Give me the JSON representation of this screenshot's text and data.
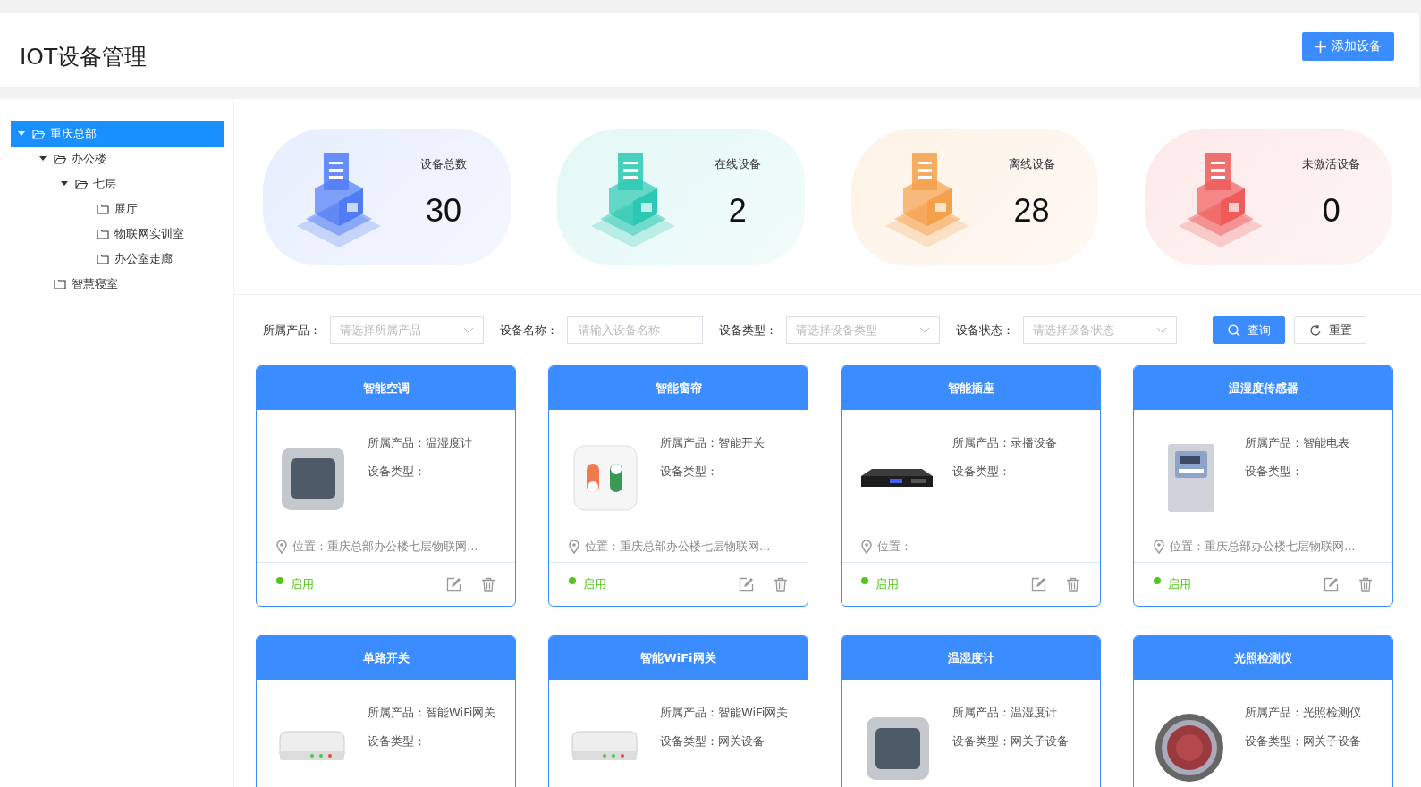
{
  "header": {
    "title": "IOT设备管理",
    "add_button": "添加设备"
  },
  "tree": [
    {
      "label": "重庆总部",
      "selected": true,
      "expanded": true,
      "children": [
        {
          "label": "办公楼",
          "selected": false,
          "expanded": true,
          "children": [
            {
              "label": "七层",
              "selected": false,
              "expanded": true,
              "children": [
                {
                  "label": "展厅",
                  "selected": false,
                  "expanded": false
                },
                {
                  "label": "物联网实训室",
                  "selected": false,
                  "expanded": false
                },
                {
                  "label": "办公室走廊",
                  "selected": false,
                  "expanded": false
                }
              ]
            }
          ]
        },
        {
          "label": "智慧寝室",
          "selected": false,
          "expanded": false
        }
      ]
    }
  ],
  "stats": [
    {
      "label": "设备总数",
      "value": "30",
      "color": "#4f7cf5"
    },
    {
      "label": "在线设备",
      "value": "2",
      "color": "#2bc9b4"
    },
    {
      "label": "离线设备",
      "value": "28",
      "color": "#f5a04a"
    },
    {
      "label": "未激活设备",
      "value": "0",
      "color": "#ef5b5b"
    }
  ],
  "filters": [
    {
      "kind": "select",
      "label": "所属产品：",
      "placeholder": "请选择所属产品"
    },
    {
      "kind": "input",
      "label": "设备名称：",
      "placeholder": "请输入设备名称"
    },
    {
      "kind": "select",
      "label": "设备类型：",
      "placeholder": "请选择设备类型"
    },
    {
      "kind": "select",
      "label": "设备状态：",
      "placeholder": "请选择设备状态"
    }
  ],
  "buttons": [
    {
      "kind": "search",
      "label": "查询"
    },
    {
      "kind": "reset",
      "label": "重置"
    }
  ],
  "devices": [
    {
      "title": "智能空调",
      "fields": [
        {
          "label": "所属产品：",
          "value": "温湿度计"
        },
        {
          "label": "设备类型："
        }
      ],
      "location": {
        "label": "位置：",
        "value": "重庆总部办公楼七层物联网..."
      },
      "status": {
        "label": "启用",
        "on": true
      }
    },
    {
      "title": "智能窗帘",
      "fields": [
        {
          "label": "所属产品：",
          "value": "智能开关"
        },
        {
          "label": "设备类型："
        }
      ],
      "location": {
        "label": "位置：",
        "value": "重庆总部办公楼七层物联网..."
      },
      "status": {
        "label": "启用",
        "on": true
      }
    },
    {
      "title": "智能插座",
      "fields": [
        {
          "label": "所属产品：",
          "value": "录播设备"
        },
        {
          "label": "设备类型："
        }
      ],
      "location": {
        "label": "位置："
      },
      "status": {
        "label": "启用",
        "on": true
      }
    },
    {
      "title": "温湿度传感器",
      "fields": [
        {
          "label": "所属产品：",
          "value": "智能电表"
        },
        {
          "label": "设备类型："
        }
      ],
      "location": {
        "label": "位置：",
        "value": "重庆总部办公楼七层物联网..."
      },
      "status": {
        "label": "启用",
        "on": true
      }
    },
    {
      "title": "单路开关",
      "fields": [
        {
          "label": "所属产品：",
          "value": "智能WiFi网关"
        },
        {
          "label": "设备类型："
        }
      ]
    },
    {
      "title": "智能WiFi网关",
      "fields": [
        {
          "label": "所属产品：",
          "value": "智能WiFi网关"
        },
        {
          "label": "设备类型：",
          "value": "网关设备"
        }
      ]
    },
    {
      "title": "温湿度计",
      "fields": [
        {
          "label": "所属产品：",
          "value": "温湿度计"
        },
        {
          "label": "设备类型：",
          "value": "网关子设备"
        }
      ]
    },
    {
      "title": "光照检测仪",
      "fields": [
        {
          "label": "所属产品：",
          "value": "光照检测仪"
        },
        {
          "label": "设备类型：",
          "value": "网关子设备"
        }
      ]
    }
  ]
}
